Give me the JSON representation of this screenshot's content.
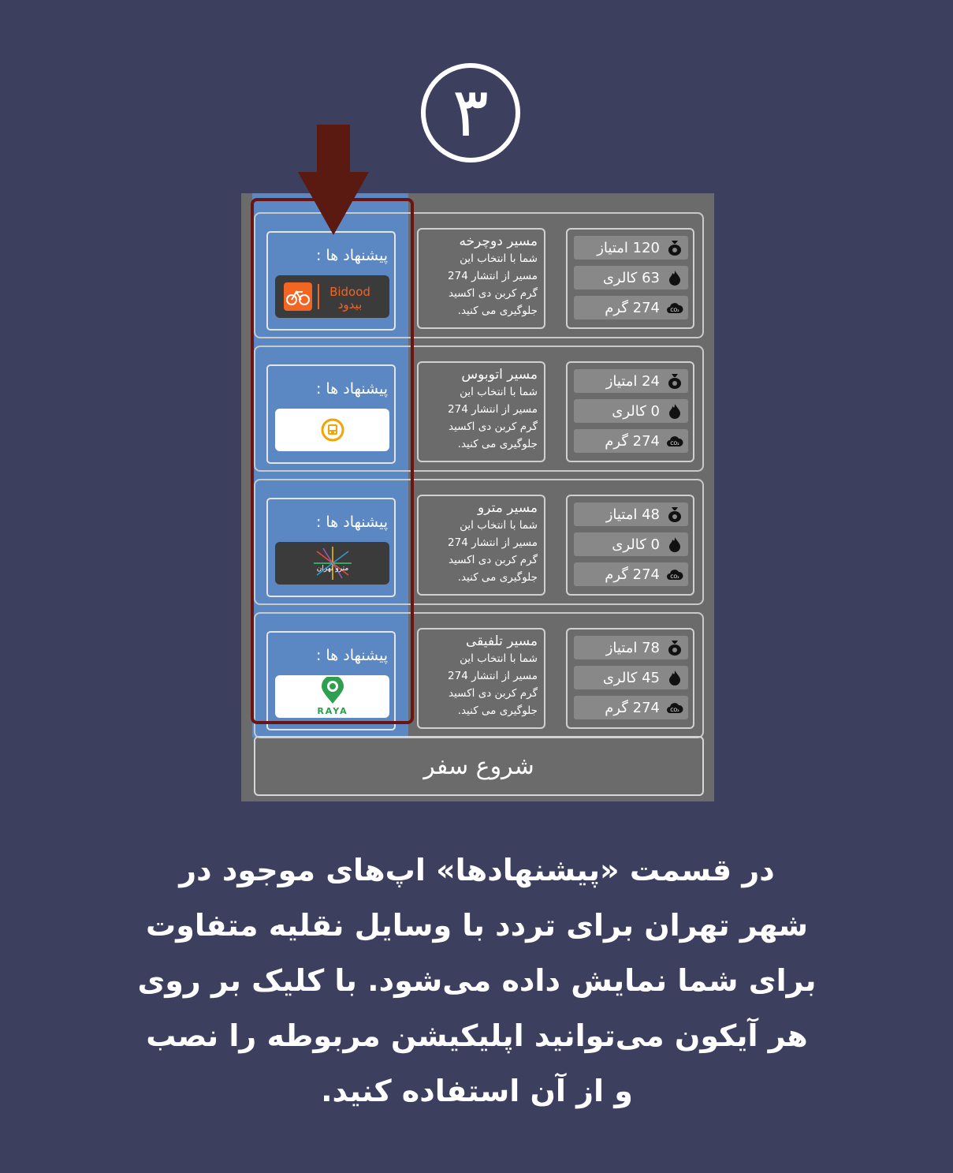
{
  "step_number": "۳",
  "rows": [
    {
      "suggestion_label": "پیشنهاد ها :",
      "app_name": "بیدود",
      "app_logo": "bidood-logo",
      "title": "مسیر دوچرخه",
      "body": [
        "شما با انتخاب این",
        "مسیر از انتشار 274",
        "گرم کربن دی اکسید",
        "جلوگیری می کنید."
      ],
      "points": "120 امتیاز",
      "calories": "63 کالری",
      "carbon": "274 گرم"
    },
    {
      "suggestion_label": "پیشنهاد ها :",
      "app_name": "",
      "app_logo": "bus-logo",
      "title": "مسیر اتوبوس",
      "body": [
        "شما با انتخاب این",
        "مسیر از انتشار 274",
        "گرم کربن دی اکسید",
        "جلوگیری می کنید."
      ],
      "points": "24 امتیاز",
      "calories": "0 کالری",
      "carbon": "274 گرم"
    },
    {
      "suggestion_label": "پیشنهاد ها :",
      "app_name": "مترو تهران",
      "app_logo": "metro-tehran-logo",
      "title": "مسیر مترو",
      "body": [
        "شما با انتخاب این",
        "مسیر از انتشار 274",
        "گرم کربن دی اکسید",
        "جلوگیری می کنید."
      ],
      "points": "48 امتیاز",
      "calories": "0 کالری",
      "carbon": "274 گرم"
    },
    {
      "suggestion_label": "پیشنهاد ها :",
      "app_name": "RAYA",
      "app_logo": "raya-logo",
      "title": "مسیر تلفیقی",
      "body": [
        "شما با انتخاب این",
        "مسیر از انتشار 274",
        "گرم کربن دی اکسید",
        "جلوگیری می کنید."
      ],
      "points": "78 امتیاز",
      "calories": "45 کالری",
      "carbon": "274 گرم"
    }
  ],
  "start_button": "شروع سفر",
  "caption_lines": [
    "در قسمت «پیشنهادها» اپ‌های موجود در",
    "شهر تهران برای تردد با  وسایل نقلیه متفاوت",
    "برای شما نمایش داده می‌شود. با کلیک بر روی",
    "هر آیکون می‌توانید اپلیکیشن مربوطه را نصب",
    "و از آن استفاده کنید."
  ],
  "colors": {
    "background": "#3d3f5f",
    "screen": "#6b6b6b",
    "suggestion_panel": "#5b87c2",
    "highlight": "#6b1414",
    "arrow": "#5a1a12",
    "bidood_orange": "#f26522",
    "raya_green": "#2e9e4f"
  },
  "icons": {
    "points": "money-bag-icon",
    "calories": "flame-icon",
    "carbon": "co2-cloud-icon"
  }
}
